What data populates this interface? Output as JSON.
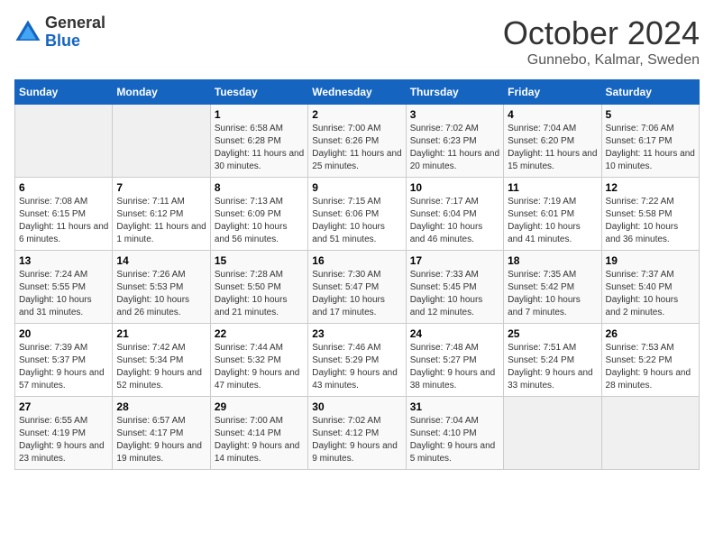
{
  "logo": {
    "general": "General",
    "blue": "Blue"
  },
  "title": "October 2024",
  "subtitle": "Gunnebo, Kalmar, Sweden",
  "days_of_week": [
    "Sunday",
    "Monday",
    "Tuesday",
    "Wednesday",
    "Thursday",
    "Friday",
    "Saturday"
  ],
  "weeks": [
    [
      {
        "day": "",
        "info": ""
      },
      {
        "day": "",
        "info": ""
      },
      {
        "day": "1",
        "info": "Sunrise: 6:58 AM\nSunset: 6:28 PM\nDaylight: 11 hours and 30 minutes."
      },
      {
        "day": "2",
        "info": "Sunrise: 7:00 AM\nSunset: 6:26 PM\nDaylight: 11 hours and 25 minutes."
      },
      {
        "day": "3",
        "info": "Sunrise: 7:02 AM\nSunset: 6:23 PM\nDaylight: 11 hours and 20 minutes."
      },
      {
        "day": "4",
        "info": "Sunrise: 7:04 AM\nSunset: 6:20 PM\nDaylight: 11 hours and 15 minutes."
      },
      {
        "day": "5",
        "info": "Sunrise: 7:06 AM\nSunset: 6:17 PM\nDaylight: 11 hours and 10 minutes."
      }
    ],
    [
      {
        "day": "6",
        "info": "Sunrise: 7:08 AM\nSunset: 6:15 PM\nDaylight: 11 hours and 6 minutes."
      },
      {
        "day": "7",
        "info": "Sunrise: 7:11 AM\nSunset: 6:12 PM\nDaylight: 11 hours and 1 minute."
      },
      {
        "day": "8",
        "info": "Sunrise: 7:13 AM\nSunset: 6:09 PM\nDaylight: 10 hours and 56 minutes."
      },
      {
        "day": "9",
        "info": "Sunrise: 7:15 AM\nSunset: 6:06 PM\nDaylight: 10 hours and 51 minutes."
      },
      {
        "day": "10",
        "info": "Sunrise: 7:17 AM\nSunset: 6:04 PM\nDaylight: 10 hours and 46 minutes."
      },
      {
        "day": "11",
        "info": "Sunrise: 7:19 AM\nSunset: 6:01 PM\nDaylight: 10 hours and 41 minutes."
      },
      {
        "day": "12",
        "info": "Sunrise: 7:22 AM\nSunset: 5:58 PM\nDaylight: 10 hours and 36 minutes."
      }
    ],
    [
      {
        "day": "13",
        "info": "Sunrise: 7:24 AM\nSunset: 5:55 PM\nDaylight: 10 hours and 31 minutes."
      },
      {
        "day": "14",
        "info": "Sunrise: 7:26 AM\nSunset: 5:53 PM\nDaylight: 10 hours and 26 minutes."
      },
      {
        "day": "15",
        "info": "Sunrise: 7:28 AM\nSunset: 5:50 PM\nDaylight: 10 hours and 21 minutes."
      },
      {
        "day": "16",
        "info": "Sunrise: 7:30 AM\nSunset: 5:47 PM\nDaylight: 10 hours and 17 minutes."
      },
      {
        "day": "17",
        "info": "Sunrise: 7:33 AM\nSunset: 5:45 PM\nDaylight: 10 hours and 12 minutes."
      },
      {
        "day": "18",
        "info": "Sunrise: 7:35 AM\nSunset: 5:42 PM\nDaylight: 10 hours and 7 minutes."
      },
      {
        "day": "19",
        "info": "Sunrise: 7:37 AM\nSunset: 5:40 PM\nDaylight: 10 hours and 2 minutes."
      }
    ],
    [
      {
        "day": "20",
        "info": "Sunrise: 7:39 AM\nSunset: 5:37 PM\nDaylight: 9 hours and 57 minutes."
      },
      {
        "day": "21",
        "info": "Sunrise: 7:42 AM\nSunset: 5:34 PM\nDaylight: 9 hours and 52 minutes."
      },
      {
        "day": "22",
        "info": "Sunrise: 7:44 AM\nSunset: 5:32 PM\nDaylight: 9 hours and 47 minutes."
      },
      {
        "day": "23",
        "info": "Sunrise: 7:46 AM\nSunset: 5:29 PM\nDaylight: 9 hours and 43 minutes."
      },
      {
        "day": "24",
        "info": "Sunrise: 7:48 AM\nSunset: 5:27 PM\nDaylight: 9 hours and 38 minutes."
      },
      {
        "day": "25",
        "info": "Sunrise: 7:51 AM\nSunset: 5:24 PM\nDaylight: 9 hours and 33 minutes."
      },
      {
        "day": "26",
        "info": "Sunrise: 7:53 AM\nSunset: 5:22 PM\nDaylight: 9 hours and 28 minutes."
      }
    ],
    [
      {
        "day": "27",
        "info": "Sunrise: 6:55 AM\nSunset: 4:19 PM\nDaylight: 9 hours and 23 minutes."
      },
      {
        "day": "28",
        "info": "Sunrise: 6:57 AM\nSunset: 4:17 PM\nDaylight: 9 hours and 19 minutes."
      },
      {
        "day": "29",
        "info": "Sunrise: 7:00 AM\nSunset: 4:14 PM\nDaylight: 9 hours and 14 minutes."
      },
      {
        "day": "30",
        "info": "Sunrise: 7:02 AM\nSunset: 4:12 PM\nDaylight: 9 hours and 9 minutes."
      },
      {
        "day": "31",
        "info": "Sunrise: 7:04 AM\nSunset: 4:10 PM\nDaylight: 9 hours and 5 minutes."
      },
      {
        "day": "",
        "info": ""
      },
      {
        "day": "",
        "info": ""
      }
    ]
  ]
}
